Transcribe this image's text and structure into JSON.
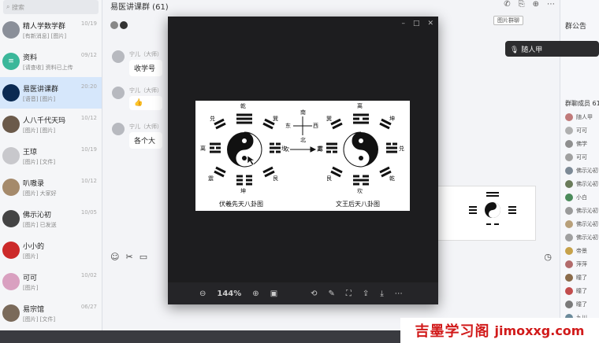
{
  "chat_list": {
    "search_placeholder": "搜索",
    "items": [
      {
        "name": "精人学数学群",
        "preview": "[有新消息] [图片]",
        "time": "10/19",
        "color": "#8a8f99",
        "initial": ""
      },
      {
        "name": "资料",
        "preview": "[请查收] 资料已上传",
        "time": "09/12",
        "color": "#3bb79a",
        "initial": "≡"
      },
      {
        "name": "易医讲课群",
        "preview": "[语音] [图片]",
        "time": "20:20",
        "color": "#0b2a52",
        "initial": ""
      },
      {
        "name": "人八千代天玛",
        "preview": "[图片] [图片]",
        "time": "10/12",
        "color": "#6b5a4a",
        "initial": ""
      },
      {
        "name": "王琼",
        "preview": "[图片] [文件]",
        "time": "10/19",
        "color": "#c8c8cc",
        "initial": ""
      },
      {
        "name": "叭嗷录",
        "preview": "[图片] 大家好",
        "time": "10/12",
        "color": "#a58a6b",
        "initial": ""
      },
      {
        "name": "佛示沁初",
        "preview": "[图片] 已发送",
        "time": "10/05",
        "color": "#444444",
        "initial": ""
      },
      {
        "name": "小小的",
        "preview": "[图片]",
        "time": "",
        "color": "#cc2a2a",
        "initial": ""
      },
      {
        "name": "可可",
        "preview": "[图片]",
        "time": "10/02",
        "color": "#d9a0c0",
        "initial": ""
      },
      {
        "name": "易宗馆",
        "preview": "[图片] [文件]",
        "time": "06/27",
        "color": "#7a6a5a",
        "initial": ""
      }
    ]
  },
  "chat": {
    "title": "易医讲课群 (61)",
    "top_button": "图片群聊",
    "messages": [
      {
        "sender": "宁儿（大师）",
        "text": "收学号"
      },
      {
        "sender": "宁儿（大师）",
        "text": "👍"
      },
      {
        "sender": "宁儿（大师）",
        "text": "各个大"
      }
    ]
  },
  "right_panel": {
    "title": "群公告",
    "members_title": "群聊成员 61",
    "members": [
      {
        "name": "随人甲",
        "color": "#c07a7a"
      },
      {
        "name": "可可",
        "color": "#b0b0b0"
      },
      {
        "name": "佛学",
        "color": "#8f8f8f"
      },
      {
        "name": "可可",
        "color": "#a0a0a0"
      },
      {
        "name": "佛示沁初",
        "color": "#7d8a96"
      },
      {
        "name": "佛示沁初",
        "color": "#6a7b5a"
      },
      {
        "name": "小白",
        "color": "#4b8b5b"
      },
      {
        "name": "佛示沁初",
        "color": "#9a9a9a"
      },
      {
        "name": "佛示沁初",
        "color": "#b8a07a"
      },
      {
        "name": "佛示沁初",
        "color": "#a0a0a0"
      },
      {
        "name": "帝景",
        "color": "#c7a24a"
      },
      {
        "name": "萍萍",
        "color": "#b26b6b"
      },
      {
        "name": "瞳了",
        "color": "#8a6b4a"
      },
      {
        "name": "瞳了",
        "color": "#c24d4d"
      },
      {
        "name": "瞳了",
        "color": "#7a7a7a"
      },
      {
        "name": "九川",
        "color": "#6a8a9a"
      }
    ]
  },
  "tooltip": {
    "text": "🎙 随人甲"
  },
  "viewer": {
    "zoom": "144%",
    "card": {
      "left_caption": "伏羲先天八卦图",
      "right_caption": "文王后天八卦图",
      "center_compass": [
        "南",
        "东",
        "西",
        "北"
      ],
      "left_labels": [
        "乾",
        "兑",
        "离",
        "震",
        "坤",
        "艮",
        "坎",
        "巽"
      ],
      "right_labels": [
        "离",
        "巽",
        "坤",
        "震",
        "兑",
        "艮",
        "坎",
        "乾"
      ],
      "arrow_left": "坎",
      "arrow_right": "离"
    }
  },
  "watermark": {
    "cn": "吉墨学习阁",
    "en": "jimoxxg.com"
  }
}
